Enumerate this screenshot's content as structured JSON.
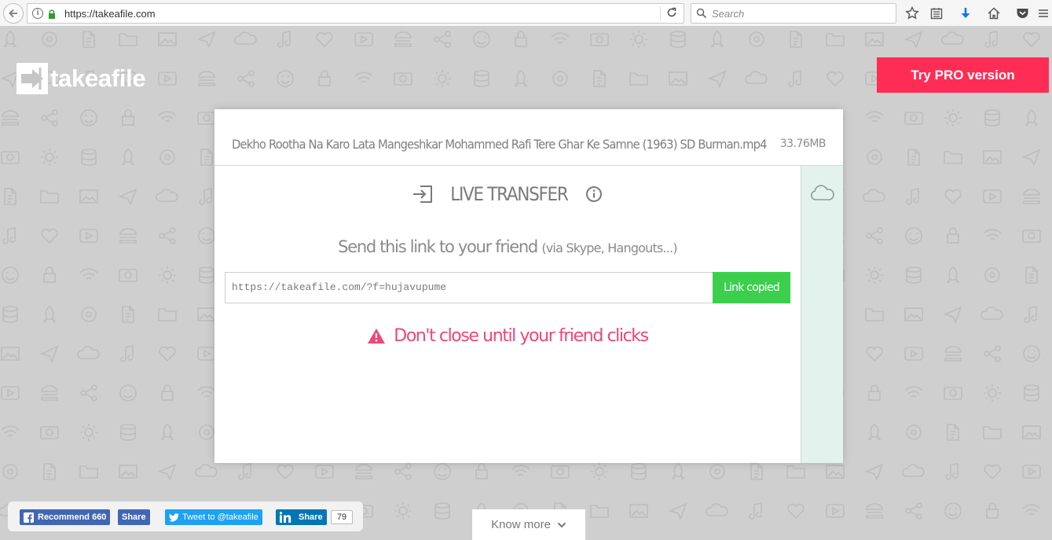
{
  "browser": {
    "url": "https://takeafile.com",
    "search_placeholder": "Search"
  },
  "header": {
    "logo_text": "takeafile",
    "pro_button": "Try PRO version"
  },
  "transfer": {
    "file_name": "Dekho Rootha Na Karo Lata Mangeshkar Mohammed Rafi Tere Ghar Ke Samne (1963) SD Burman.mp4",
    "file_size": "33.76MB",
    "mode_title": "LIVE TRANSFER",
    "send_text": "Send this link to your friend",
    "send_subtext": "(via Skype, Hangouts...)",
    "link_value": "https://takeafile.com/?f=hujavupume",
    "copy_button": "Link copied",
    "warning": "Don't close until your friend clicks"
  },
  "social": {
    "fb_recommend": "Recommend 660",
    "fb_share": "Share",
    "tweet": "Tweet to @takeafile",
    "linkedin_share": "Share",
    "linkedin_count": "79"
  },
  "footer": {
    "know_more": "Know more"
  },
  "colors": {
    "accent_pink": "#ff2d55",
    "warning_pink": "#f0457a",
    "copy_green": "#3ccf4e",
    "side_panel": "#e3f2ed",
    "background": "#cfcfcf"
  }
}
